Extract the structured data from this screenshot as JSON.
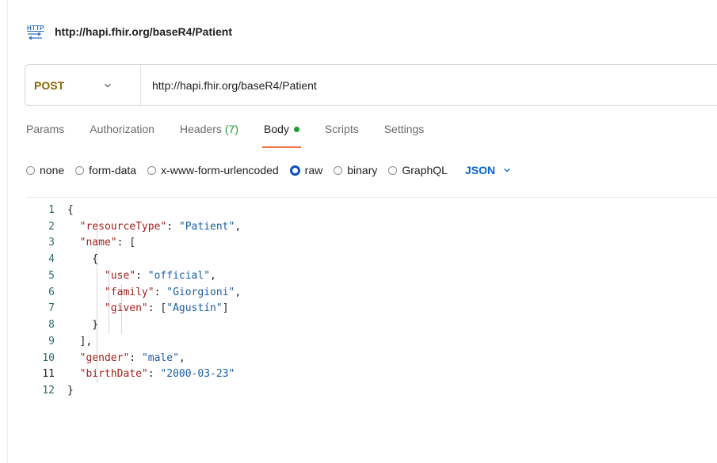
{
  "request": {
    "title": "http://hapi.fhir.org/baseR4/Patient",
    "badge_text": "HTTP",
    "method": "POST",
    "url": "http://hapi.fhir.org/baseR4/Patient"
  },
  "tabs": [
    {
      "label": "Params"
    },
    {
      "label": "Authorization"
    },
    {
      "label": "Headers",
      "count": "(7)"
    },
    {
      "label": "Body",
      "active": true,
      "indicator": "green-dot"
    },
    {
      "label": "Scripts"
    },
    {
      "label": "Settings"
    }
  ],
  "body_types": [
    {
      "label": "none",
      "selected": false
    },
    {
      "label": "form-data",
      "selected": false
    },
    {
      "label": "x-www-form-urlencoded",
      "selected": false
    },
    {
      "label": "raw",
      "selected": true
    },
    {
      "label": "binary",
      "selected": false
    },
    {
      "label": "GraphQL",
      "selected": false
    }
  ],
  "format": "JSON",
  "colors": {
    "method": "#8a6500",
    "accent_tab": "#f26b3a",
    "json_select": "#0b63d6",
    "dot": "#1a9e37",
    "json_key": "#a3211c",
    "json_string": "#1a5fa8"
  },
  "editor": {
    "lines": [
      {
        "n": "1",
        "tokens": [
          [
            "p",
            "{"
          ]
        ]
      },
      {
        "n": "2",
        "tokens": [
          [
            "p",
            "  "
          ],
          [
            "k",
            "\"resourceType\""
          ],
          [
            "p",
            ": "
          ],
          [
            "s",
            "\"Patient\""
          ],
          [
            "p",
            ","
          ]
        ]
      },
      {
        "n": "3",
        "tokens": [
          [
            "p",
            "  "
          ],
          [
            "k",
            "\"name\""
          ],
          [
            "p",
            ": ["
          ]
        ]
      },
      {
        "n": "4",
        "tokens": [
          [
            "p",
            "    {"
          ]
        ]
      },
      {
        "n": "5",
        "tokens": [
          [
            "p",
            "      "
          ],
          [
            "k",
            "\"use\""
          ],
          [
            "p",
            ": "
          ],
          [
            "s",
            "\"official\""
          ],
          [
            "p",
            ","
          ]
        ]
      },
      {
        "n": "6",
        "tokens": [
          [
            "p",
            "      "
          ],
          [
            "k",
            "\"family\""
          ],
          [
            "p",
            ": "
          ],
          [
            "s",
            "\"Giorgioni\""
          ],
          [
            "p",
            ","
          ]
        ]
      },
      {
        "n": "7",
        "tokens": [
          [
            "p",
            "      "
          ],
          [
            "k",
            "\"given\""
          ],
          [
            "p",
            ": ["
          ],
          [
            "s",
            "\"Agustín\""
          ],
          [
            "p",
            "]"
          ]
        ]
      },
      {
        "n": "8",
        "tokens": [
          [
            "p",
            "    }"
          ]
        ]
      },
      {
        "n": "9",
        "tokens": [
          [
            "p",
            "  ],"
          ]
        ]
      },
      {
        "n": "10",
        "tokens": [
          [
            "p",
            "  "
          ],
          [
            "k",
            "\"gender\""
          ],
          [
            "p",
            ": "
          ],
          [
            "s",
            "\"male\""
          ],
          [
            "p",
            ","
          ]
        ]
      },
      {
        "n": "11",
        "tokens": [
          [
            "p",
            "  "
          ],
          [
            "k",
            "\"birthDate\""
          ],
          [
            "p",
            ": "
          ],
          [
            "s",
            "\"2000-03-23\""
          ]
        ]
      },
      {
        "n": "12",
        "tokens": [
          [
            "p",
            "}"
          ]
        ]
      }
    ]
  }
}
